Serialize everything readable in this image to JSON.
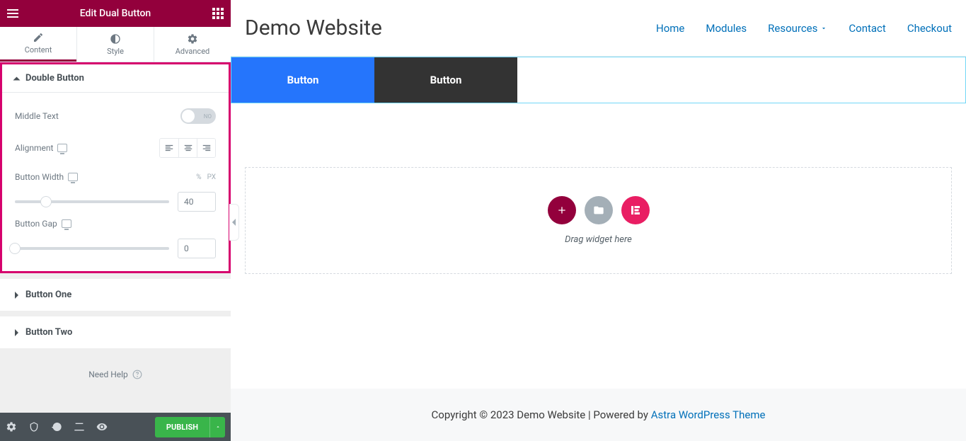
{
  "sidebar": {
    "title": "Edit Dual Button",
    "tabs": {
      "content": "Content",
      "style": "Style",
      "advanced": "Advanced"
    },
    "sections": {
      "double_button": {
        "label": "Double Button",
        "middle_text_label": "Middle Text",
        "middle_text_toggle_label": "NO",
        "alignment_label": "Alignment",
        "button_width_label": "Button Width",
        "button_width_value": "40",
        "button_width_unit": "PX",
        "button_gap_label": "Button Gap",
        "button_gap_value": "0"
      },
      "button_one_label": "Button One",
      "button_two_label": "Button Two"
    },
    "need_help": "Need Help",
    "publish": "PUBLISH"
  },
  "preview": {
    "site_title": "Demo Website",
    "nav": [
      "Home",
      "Modules",
      "Resources",
      "Contact",
      "Checkout"
    ],
    "button1": "Button",
    "button2": "Button",
    "drop_text": "Drag widget here",
    "footer_text": "Copyright © 2023 Demo Website | Powered by ",
    "footer_link": "Astra WordPress Theme"
  }
}
